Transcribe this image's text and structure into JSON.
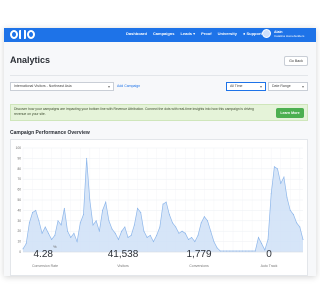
{
  "app": {
    "logo_letters": [
      "O",
      "H",
      "O"
    ]
  },
  "nav": {
    "items": [
      {
        "label": "Dashboard",
        "dropdown": false
      },
      {
        "label": "Campaigns",
        "dropdown": false
      },
      {
        "label": "Leads",
        "dropdown": true
      },
      {
        "label": "Proof",
        "dropdown": false
      },
      {
        "label": "University",
        "dropdown": false
      },
      {
        "label": "Support",
        "dropdown": false
      }
    ],
    "user_name": "Alain",
    "user_company": "Catalina Homebuilders"
  },
  "page": {
    "title": "Analytics",
    "go_back_label": "Go Back"
  },
  "filters": {
    "campaign_value": "International Visitors - Northeast Asia",
    "add_campaign_label": "Add Campaign",
    "time_value": "All Time",
    "date_range_value": "Date Range"
  },
  "banner": {
    "text": "Discover how your campaigns are impacting your bottom line with Revenue Attribution. Connect the dots with real-time insights into how this campaign is driving revenue on your site.",
    "button_label": "Learn More"
  },
  "colors": {
    "brand": "#1e73e8",
    "chart_line": "#8db6ea",
    "chart_fill": "#cfe0f7",
    "success": "#4caf50"
  },
  "chart_data": {
    "type": "area",
    "title": "Campaign Performance Overview",
    "ylim": [
      0,
      100
    ],
    "yticks": [
      0,
      10,
      20,
      30,
      40,
      50,
      60,
      70,
      80,
      90,
      100
    ],
    "grid": true,
    "values": [
      3,
      8,
      28,
      38,
      40,
      30,
      18,
      24,
      18,
      12,
      16,
      30,
      26,
      42,
      20,
      14,
      18,
      10,
      28,
      36,
      90,
      50,
      26,
      30,
      20,
      40,
      48,
      30,
      22,
      18,
      12,
      20,
      24,
      14,
      16,
      26,
      42,
      38,
      20,
      14,
      16,
      10,
      16,
      24,
      46,
      48,
      36,
      28,
      24,
      18,
      20,
      18,
      12,
      14,
      10,
      16,
      28,
      34,
      30,
      20,
      10,
      4,
      1,
      1,
      1,
      1,
      1,
      1,
      1,
      1,
      1,
      1,
      1,
      1,
      14,
      8,
      2,
      12,
      56,
      82,
      80,
      66,
      72,
      52,
      40,
      36,
      28,
      24,
      12
    ]
  },
  "stats": [
    {
      "value": "4.28",
      "unit": "%",
      "label": "Conversion Rate"
    },
    {
      "value": "41,538",
      "unit": "",
      "label": "Visitors"
    },
    {
      "value": "1,779",
      "unit": "",
      "label": "Conversions"
    },
    {
      "value": "0",
      "unit": "",
      "label": "Auto Track"
    }
  ]
}
